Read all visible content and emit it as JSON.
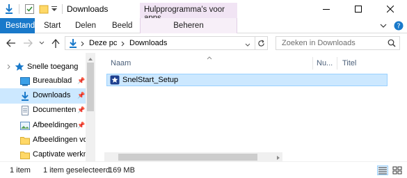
{
  "window": {
    "title": "Downloads",
    "context_tab_header": "Hulpprogramma's voor apps"
  },
  "ribbon": {
    "tabs": [
      {
        "label": "Bestand"
      },
      {
        "label": "Start"
      },
      {
        "label": "Delen"
      },
      {
        "label": "Beeld"
      },
      {
        "label": "Beheren"
      }
    ]
  },
  "address": {
    "crumbs": [
      "Deze pc",
      "Downloads"
    ],
    "search_placeholder": "Zoeken in Downloads"
  },
  "navpane": {
    "quick_access_label": "Snelle toegang",
    "items": [
      {
        "label": "Bureaublad",
        "icon": "desktop-folder-icon",
        "pinned": true
      },
      {
        "label": "Downloads",
        "icon": "downloads-folder-icon",
        "pinned": true,
        "selected": true
      },
      {
        "label": "Documenten",
        "icon": "documents-folder-icon",
        "pinned": true
      },
      {
        "label": "Afbeeldingen",
        "icon": "pictures-folder-icon",
        "pinned": true
      },
      {
        "label": "Afbeeldingen vo",
        "icon": "folder-icon",
        "pinned": false
      },
      {
        "label": "Captivate werkm",
        "icon": "folder-icon",
        "pinned": false
      }
    ]
  },
  "filelist": {
    "columns": [
      "Naam",
      "Nu...",
      "Titel"
    ],
    "files": [
      {
        "name": "SnelStart_Setup",
        "icon": "app-setup-icon",
        "selected": true
      }
    ]
  },
  "status": {
    "item_count": "1 item",
    "selected": "1 item geselecteerd",
    "size": "169 MB"
  },
  "colors": {
    "accent": "#1979ca",
    "selection": "#cce8ff",
    "context_tab": "#f1e4f4"
  }
}
